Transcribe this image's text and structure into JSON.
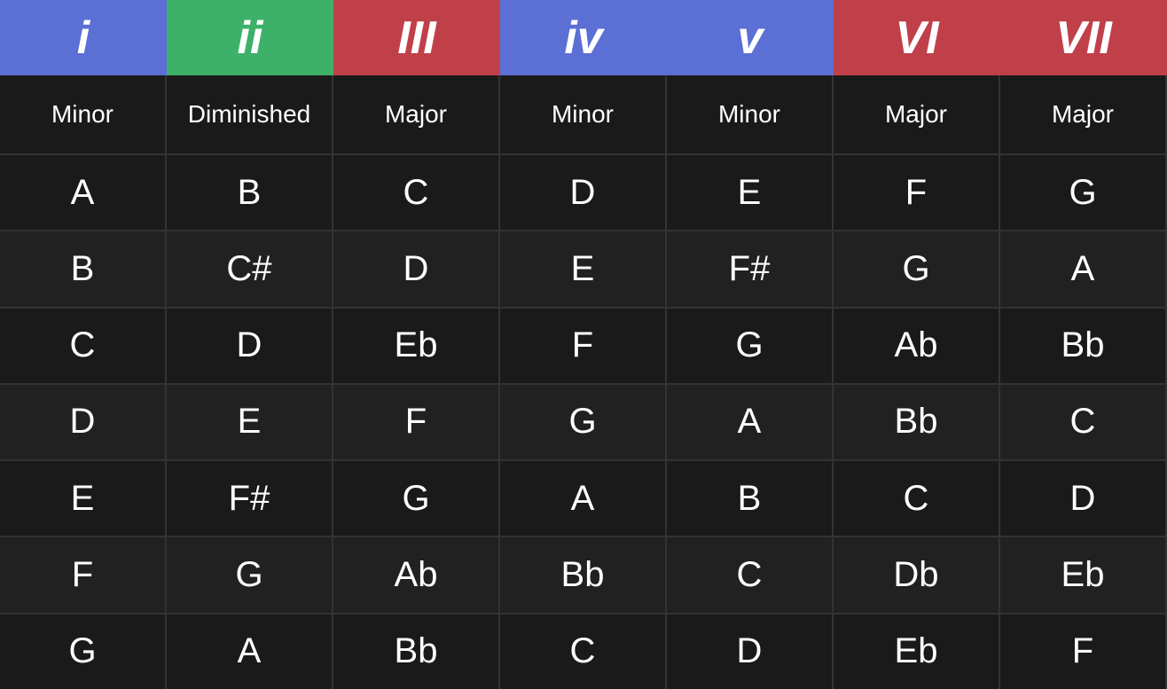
{
  "headers": [
    {
      "label": "i",
      "style": "blue"
    },
    {
      "label": "ii",
      "style": "green"
    },
    {
      "label": "III",
      "style": "red"
    },
    {
      "label": "iv",
      "style": "blue"
    },
    {
      "label": "v",
      "style": "blue"
    },
    {
      "label": "VI",
      "style": "red"
    },
    {
      "label": "VII",
      "style": "red"
    }
  ],
  "subheaders": [
    {
      "label": "Minor"
    },
    {
      "label": "Diminished"
    },
    {
      "label": "Major"
    },
    {
      "label": "Minor"
    },
    {
      "label": "Minor"
    },
    {
      "label": "Major"
    },
    {
      "label": "Major"
    }
  ],
  "rows": [
    [
      "A",
      "B",
      "C",
      "D",
      "E",
      "F",
      "G"
    ],
    [
      "B",
      "C#",
      "D",
      "E",
      "F#",
      "G",
      "A"
    ],
    [
      "C",
      "D",
      "Eb",
      "F",
      "G",
      "Ab",
      "Bb"
    ],
    [
      "D",
      "E",
      "F",
      "G",
      "A",
      "Bb",
      "C"
    ],
    [
      "E",
      "F#",
      "G",
      "A",
      "B",
      "C",
      "D"
    ],
    [
      "F",
      "G",
      "Ab",
      "Bb",
      "C",
      "Db",
      "Eb"
    ],
    [
      "G",
      "A",
      "Bb",
      "C",
      "D",
      "Eb",
      "F"
    ]
  ]
}
